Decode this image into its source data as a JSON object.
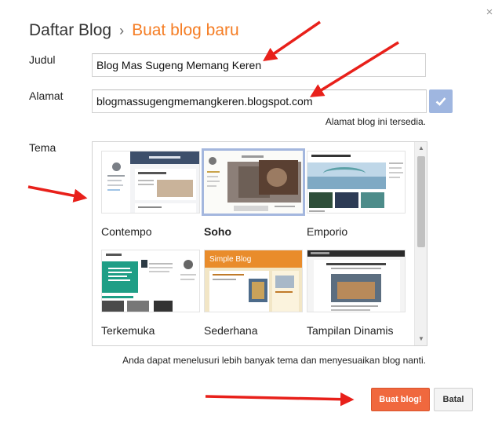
{
  "header": {
    "breadcrumb_parent": "Daftar Blog",
    "separator": "›",
    "current": "Buat blog baru",
    "close_glyph": "×"
  },
  "form": {
    "title_label": "Judul",
    "title_value": "Blog Mas Sugeng Memang Keren",
    "address_label": "Alamat",
    "address_value": "blogmassugengmemangkeren.blogspot.com",
    "address_status": "Alamat blog ini tersedia.",
    "theme_label": "Tema"
  },
  "themes": [
    {
      "name": "Contempo",
      "selected": false
    },
    {
      "name": "Soho",
      "selected": true
    },
    {
      "name": "Emporio",
      "selected": false
    },
    {
      "name": "Terkemuka",
      "selected": false
    },
    {
      "name": "Sederhana",
      "selected": false
    },
    {
      "name": "Tampilan Dinamis",
      "selected": false
    }
  ],
  "thumb_text": {
    "simple_title": "Simple Blog"
  },
  "hint": "Anda dapat menelusuri lebih banyak tema dan menyesuaikan blog nanti.",
  "actions": {
    "create_label": "Buat blog!",
    "cancel_label": "Batal"
  },
  "colors": {
    "accent": "#f57d24",
    "create_button": "#f0683e",
    "check_button": "#9fb6e0",
    "selected_border": "#a4b7de",
    "annotation_arrow": "#e8201a"
  },
  "icons": {
    "close": "close-icon",
    "check": "check-icon"
  }
}
